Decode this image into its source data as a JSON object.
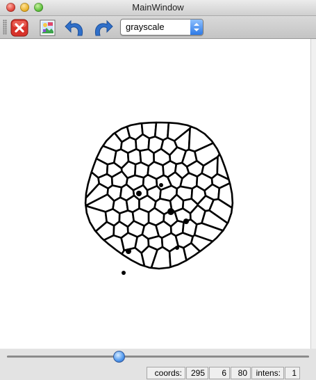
{
  "window": {
    "title": "MainWindow"
  },
  "toolbar": {
    "buttons": [
      "close-x-icon",
      "image-icon",
      "undo-arrow-icon",
      "redo-arrow-icon"
    ],
    "colormap_select": {
      "value": "grayscale"
    }
  },
  "image": {
    "description_icon": "cell-mosaic-image"
  },
  "slider": {
    "level_fraction": 0.37
  },
  "status": {
    "coords_label": "coords:",
    "x": "295",
    "y": "6",
    "z": "80",
    "intens_label": "intens:",
    "intens_value": "1"
  },
  "colors": {
    "accent": "#2f7ae6",
    "close": "#d7322a"
  }
}
